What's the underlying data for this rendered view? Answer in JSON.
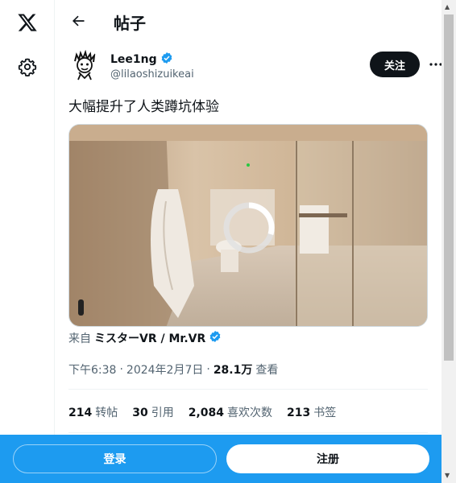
{
  "nav": {
    "logo_icon": "x-logo-icon",
    "settings_icon": "gear-icon"
  },
  "header": {
    "title": "帖子",
    "back_icon": "arrow-left-icon"
  },
  "post": {
    "author": {
      "display_name": "Lee1ng",
      "handle": "@lilaoshizuikeai",
      "verified_icon": "verified-badge-icon"
    },
    "follow_label": "关注",
    "more_icon": "more-horizontal-icon",
    "text": "大幅提升了人类蹲坑体验",
    "media_description_icon": "video-thumbnail",
    "via_prefix": "来自",
    "via_name": "ミスターVR / Mr.VR",
    "time": "下午6:38",
    "date": "2024年2月7日",
    "separator": "·",
    "views_count": "28.1万",
    "views_label": "查看",
    "stats": [
      {
        "count": "214",
        "label": "转帖"
      },
      {
        "count": "30",
        "label": "引用"
      },
      {
        "count": "2,084",
        "label": "喜欢次数"
      },
      {
        "count": "213",
        "label": "书签"
      }
    ]
  },
  "bottom_bar": {
    "login_label": "登录",
    "signup_label": "注册"
  },
  "colors": {
    "accent": "#1d9bf0",
    "text": "#0f1419",
    "muted": "#536471"
  }
}
